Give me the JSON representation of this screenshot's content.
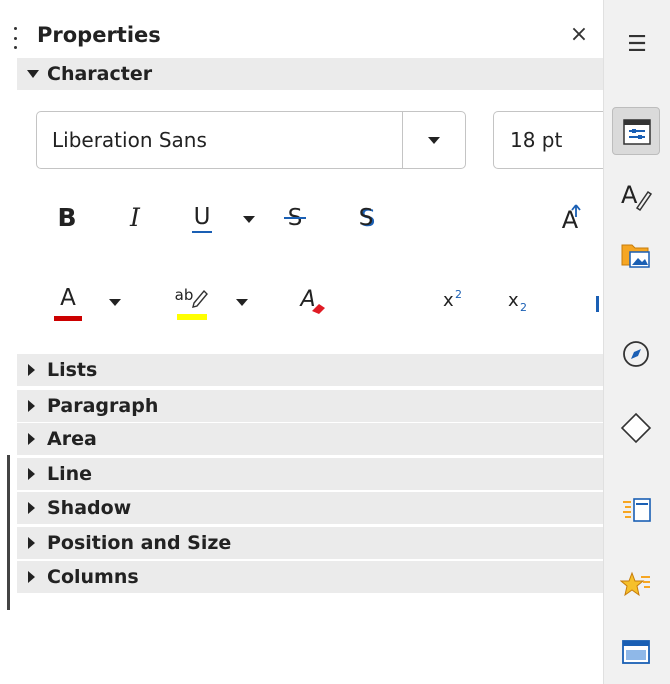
{
  "panel": {
    "title": "Properties",
    "close_symbol": "×"
  },
  "character": {
    "header": "Character",
    "font_name": "Liberation Sans",
    "font_size": "18 pt",
    "bold_glyph": "B",
    "italic_glyph": "I",
    "underline_glyph": "U",
    "strike_glyph": "S",
    "shadow_glyph": "S",
    "grow_glyph": "A",
    "font_color_glyph": "A",
    "highlight_glyph": "ab",
    "clear_glyph": "A",
    "superscript_base": "x",
    "superscript_exp": "2",
    "subscript_base": "x",
    "subscript_exp": "2",
    "font_color": "#cc0000",
    "highlight_color": "#ffff00"
  },
  "sections": [
    {
      "label": "Lists"
    },
    {
      "label": "Paragraph"
    },
    {
      "label": "Area"
    },
    {
      "label": "Line"
    },
    {
      "label": "Shadow"
    },
    {
      "label": "Position and Size"
    },
    {
      "label": "Columns"
    }
  ],
  "tabs": {
    "menu_symbol": "☰",
    "items": [
      {
        "icon": "properties-icon",
        "active": true
      },
      {
        "icon": "styles-icon"
      },
      {
        "icon": "gallery-icon"
      },
      {
        "icon": "navigator-icon"
      },
      {
        "icon": "shapes-icon"
      },
      {
        "icon": "slide-transition-icon"
      },
      {
        "icon": "animation-icon"
      },
      {
        "icon": "master-slides-icon"
      }
    ]
  }
}
